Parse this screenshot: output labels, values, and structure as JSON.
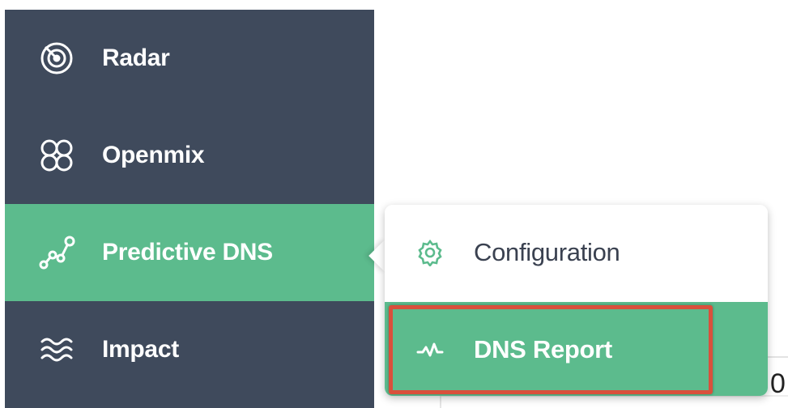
{
  "sidebar": {
    "items": [
      {
        "label": "Radar",
        "icon": "radar-icon"
      },
      {
        "label": "Openmix",
        "icon": "openmix-icon"
      },
      {
        "label": "Predictive DNS",
        "icon": "predictive-dns-icon",
        "active": true
      },
      {
        "label": "Impact",
        "icon": "impact-icon"
      }
    ]
  },
  "submenu": {
    "items": [
      {
        "label": "Configuration",
        "icon": "gear-icon"
      },
      {
        "label": "DNS Report",
        "icon": "activity-icon",
        "highlighted": true
      }
    ]
  },
  "background": {
    "partial_char": "0"
  },
  "colors": {
    "sidebar_bg": "#3f4a5c",
    "accent_green": "#5cbb8d",
    "highlight_red": "#d9503c"
  }
}
